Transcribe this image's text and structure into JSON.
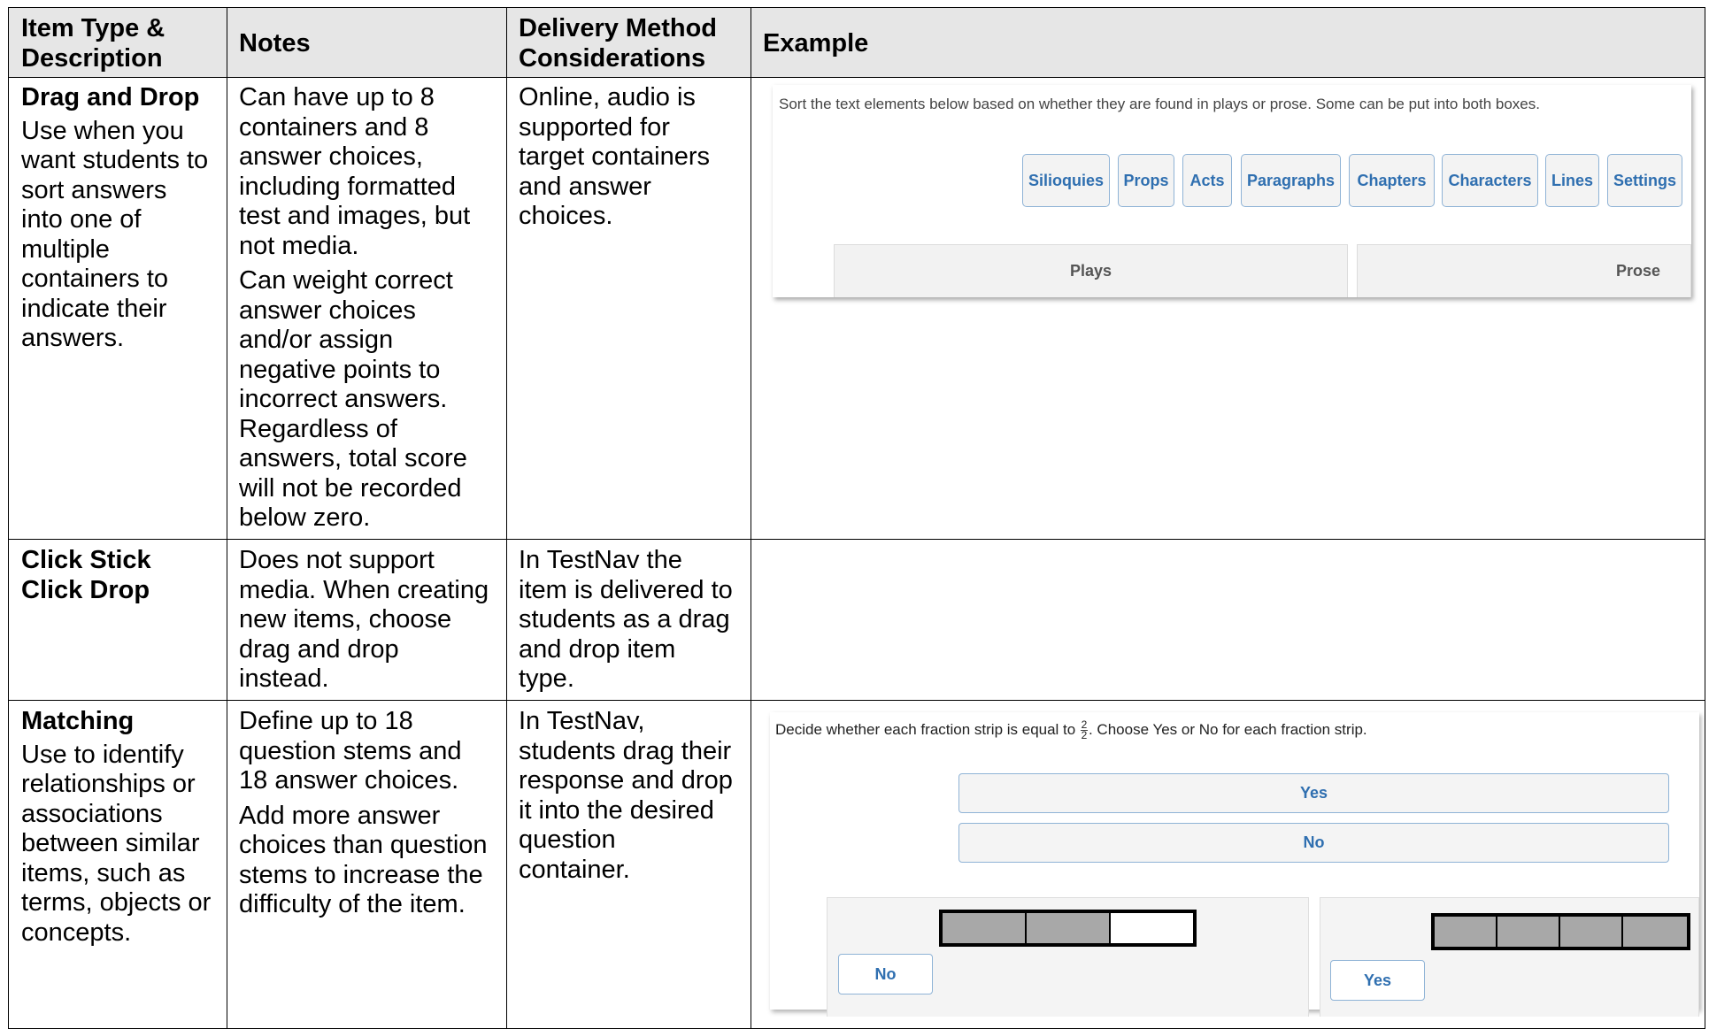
{
  "headers": {
    "item_type": [
      "Item Type &",
      "Description"
    ],
    "notes": "Notes",
    "delivery": [
      "Delivery Method",
      "Considerations"
    ],
    "example": "Example"
  },
  "rows": [
    {
      "title": "Drag and Drop",
      "description": [
        "Use when you",
        "want students to",
        "sort answers",
        "into one of",
        "multiple",
        "containers to",
        "indicate their",
        "answers."
      ],
      "notes_para1": [
        "Can have up to 8",
        "containers and 8",
        "answer choices,",
        "including formatted",
        "test and images, but",
        "not media."
      ],
      "notes_para2": [
        "Can weight correct",
        "answer choices",
        "and/or assign",
        "negative points to",
        "incorrect answers.",
        "Regardless of",
        "answers, total score",
        "will not be recorded",
        "below zero."
      ],
      "delivery": [
        "Online, audio is",
        "supported for",
        "target containers",
        "and answer",
        "choices."
      ]
    },
    {
      "title": [
        "Click Stick",
        "Click Drop"
      ],
      "notes": [
        "Does not support",
        "media. When creating",
        "new items, choose",
        "drag and drop",
        "instead."
      ],
      "delivery": [
        "In TestNav the",
        "item is delivered to",
        "students as a drag",
        "and drop item",
        "type."
      ]
    },
    {
      "title": "Matching",
      "description": [
        "Use to identify",
        "relationships or",
        "associations",
        "between similar",
        "items, such as",
        "terms, objects or",
        "concepts."
      ],
      "notes_para1": [
        "Define up to 18",
        "question stems and",
        "18 answer choices."
      ],
      "notes_para2": [
        "Add more answer",
        "choices than question",
        "stems to increase the",
        "difficulty of the item."
      ],
      "delivery": [
        "In TestNav,",
        "students drag their",
        "response and drop",
        "it into the desired",
        "question",
        "container."
      ]
    }
  ],
  "example_drag": {
    "prompt": "Sort the text elements below based on whether they are found in plays or prose. Some can be put into both boxes.",
    "chips": [
      "Silioquies",
      "Props",
      "Acts",
      "Paragraphs",
      "Chapters",
      "Characters",
      "Lines",
      "Settings"
    ],
    "targets": [
      "Plays",
      "Prose"
    ]
  },
  "example_match": {
    "prompt_before": "Decide whether each fraction strip is equal to",
    "fraction_num": "2",
    "fraction_den": "2",
    "prompt_after": ". Choose Yes or No for each fraction strip.",
    "options": [
      "Yes",
      "No"
    ],
    "strip1": {
      "filled": 2,
      "total": 3,
      "answer": "No"
    },
    "strip2": {
      "filled": 4,
      "total": 4,
      "answer": "Yes"
    }
  },
  "colors": {
    "header_bg": "#e6e6e6",
    "chip_text": "#2f6fb0",
    "chip_border": "#8fb3d6",
    "strip_fill": "#a8a8a8"
  }
}
